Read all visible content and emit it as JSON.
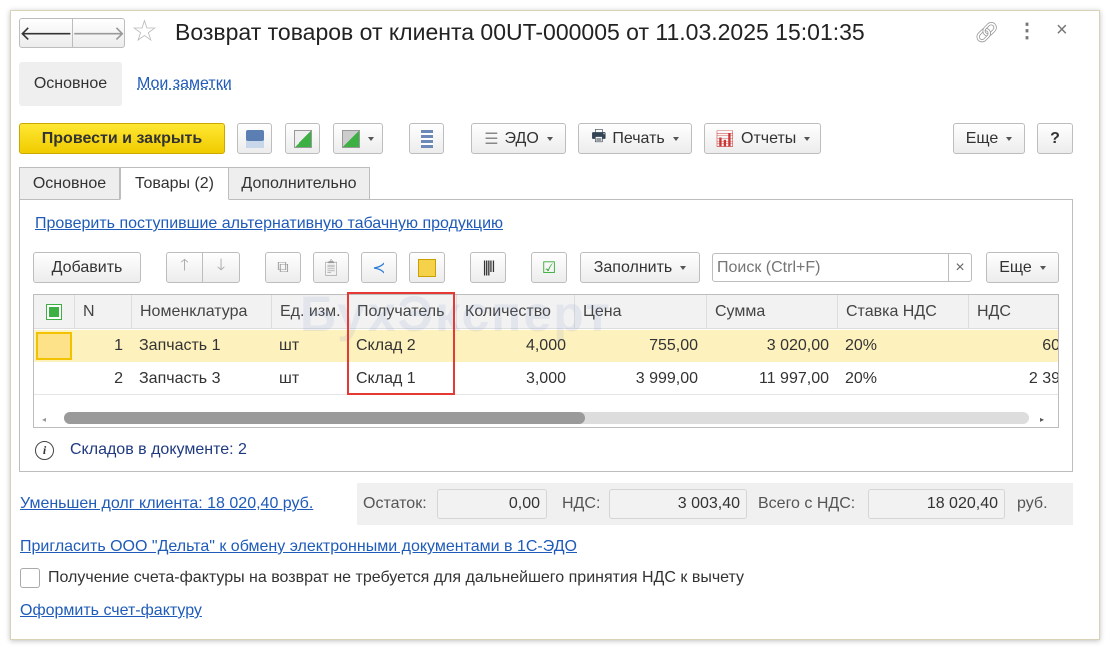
{
  "window": {
    "title": "Возврат товаров от клиента 00UT-000005 от 11.03.2025 15:01:35"
  },
  "nav": {
    "main": "Основное",
    "notes": "Мои заметки"
  },
  "toolbar": {
    "post_close": "Провести и закрыть",
    "edo": "ЭДО",
    "print": "Печать",
    "reports": "Отчеты",
    "more": "Еще",
    "help": "?"
  },
  "tabs": [
    {
      "label": "Основное"
    },
    {
      "label": "Товары (2)"
    },
    {
      "label": "Дополнительно"
    }
  ],
  "goods": {
    "check_link": "Проверить поступившие альтернативную табачную продукцию",
    "add": "Добавить",
    "fill": "Заполнить",
    "search_placeholder": "Поиск (Ctrl+F)",
    "clear": "×",
    "more": "Еще",
    "columns": [
      "N",
      "Номенклатура",
      "Ед. изм.",
      "Получатель",
      "Количество",
      "Цена",
      "Сумма",
      "Ставка НДС",
      "НДС"
    ],
    "rows": [
      {
        "n": "1",
        "item": "Запчасть 1",
        "unit": "шт",
        "recipient": "Склад 2",
        "qty": "4,000",
        "price": "755,00",
        "sum": "3 020,00",
        "rate": "20%",
        "vat": "60"
      },
      {
        "n": "2",
        "item": "Запчасть 3",
        "unit": "шт",
        "recipient": "Склад 1",
        "qty": "3,000",
        "price": "3 999,00",
        "sum": "11 997,00",
        "rate": "20%",
        "vat": "2 39"
      }
    ],
    "scroll_fraction": 0.54,
    "info": "Складов в документе: 2"
  },
  "watermark": "БухЭксперт",
  "totals": {
    "debt_link": "Уменьшен долг клиента: 18 020,40 руб.",
    "rest_label": "Остаток:",
    "rest": "0,00",
    "vat_label": "НДС:",
    "vat": "3 003,40",
    "total_label": "Всего с НДС:",
    "total": "18 020,40",
    "currency": "руб."
  },
  "footer": {
    "invite_link": "Пригласить ООО \"Дельта\" к обмену электронными документами в 1С-ЭДО",
    "checkbox_label": "Получение счета-фактуры на возврат не требуется для дальнейшего принятия НДС к вычету",
    "checkbox_checked": false,
    "invoice_link": "Оформить счет-фактуру"
  },
  "colors": {
    "accent": "#f5d400",
    "link": "#1f5bb8",
    "highlight": "#fdf1bd",
    "red": "#e53935"
  }
}
